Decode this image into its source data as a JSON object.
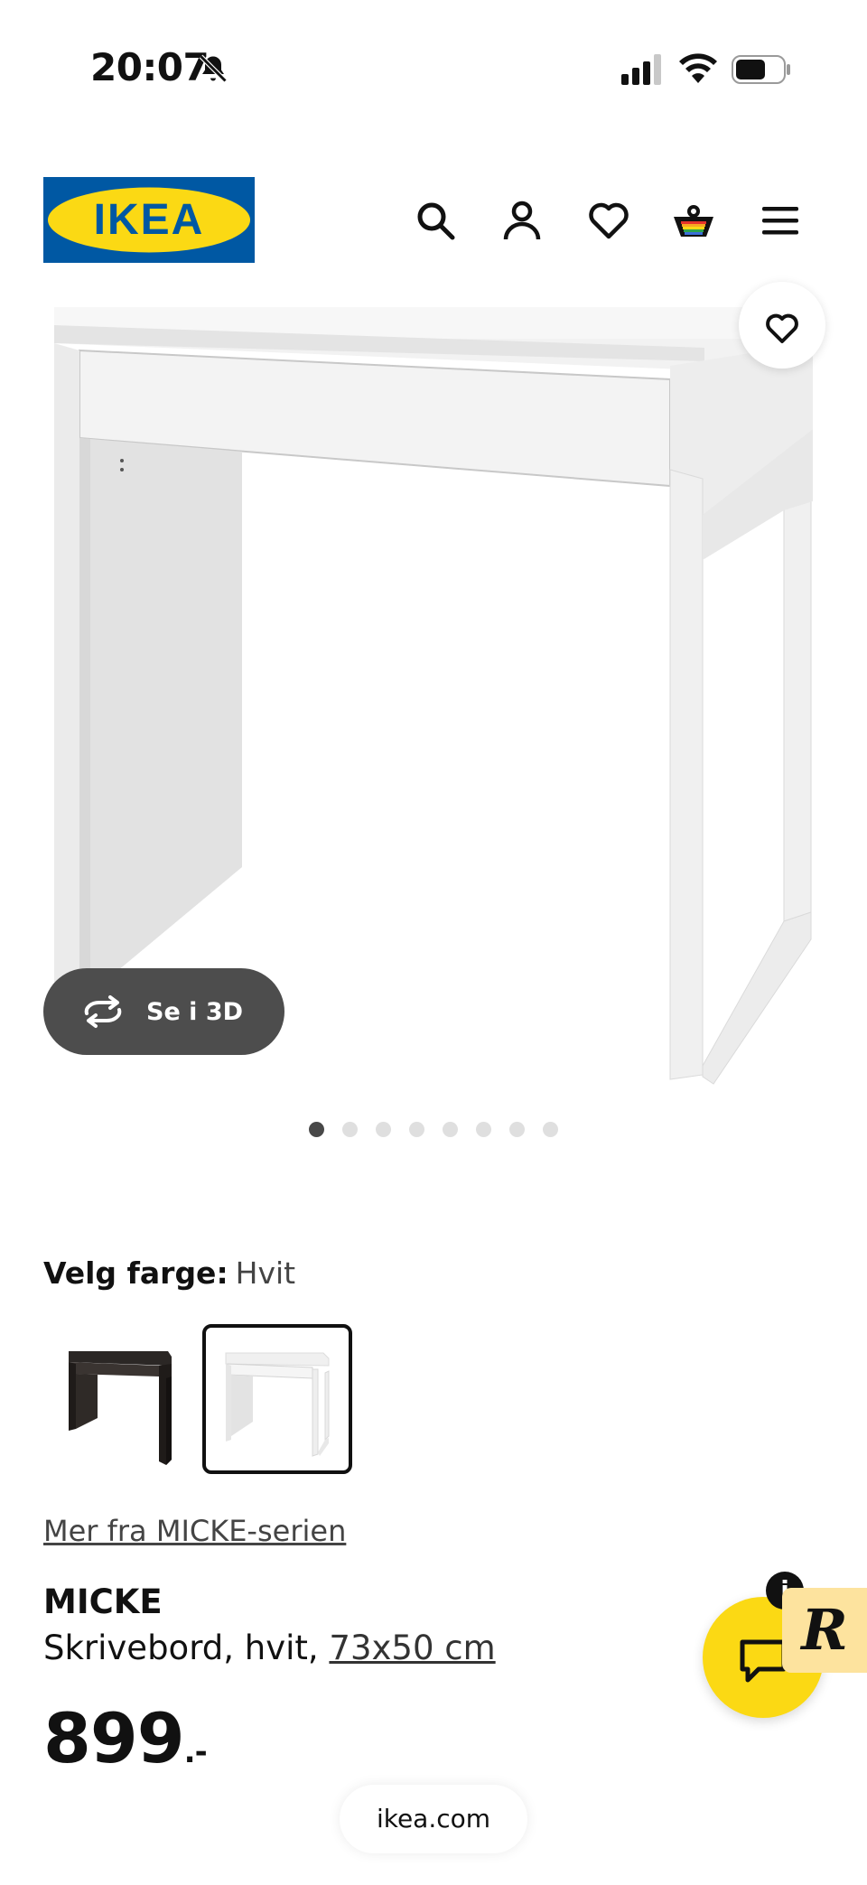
{
  "status_bar": {
    "time": "20:07",
    "icons": [
      "bell-slash-icon",
      "cellular-signal-icon",
      "wifi-icon",
      "battery-icon"
    ]
  },
  "header": {
    "logo_text": "IKEA",
    "icons": [
      "search-icon",
      "user-icon",
      "heart-icon",
      "cart-icon",
      "menu-icon"
    ],
    "colors": {
      "logo_blue": "#0058a3",
      "logo_yellow": "#fbd914"
    }
  },
  "gallery": {
    "see_3d_label": "Se i 3D",
    "dot_count": 8,
    "active_dot": 1
  },
  "color_select": {
    "label": "Velg farge:",
    "value": "Hvit",
    "options": [
      "black-brown",
      "white"
    ],
    "selected": "white"
  },
  "product": {
    "series_link": "Mer fra MICKE-serien",
    "name": "MICKE",
    "desc_prefix": "Skrivebord, hvit,",
    "dimensions": "73x50 cm",
    "price": "899",
    "price_suffix": ".-"
  },
  "chat": {
    "info_glyph": "i",
    "badge_letter": "R"
  },
  "browser": {
    "url": "ikea.com"
  }
}
